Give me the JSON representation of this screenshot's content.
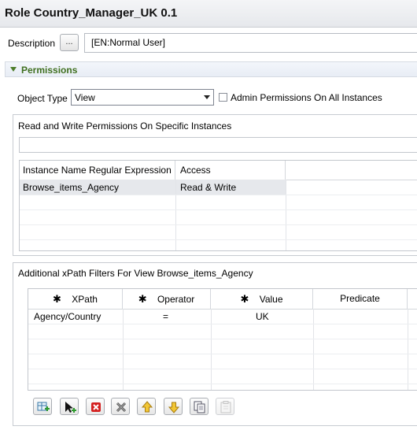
{
  "header": {
    "title": "Role Country_Manager_UK 0.1"
  },
  "description": {
    "label": "Description",
    "browse_label": "...",
    "value": "[EN:Normal User]"
  },
  "permissions": {
    "section_title": "Permissions",
    "object_type_label": "Object Type",
    "object_type_value": "View",
    "admin_checkbox_label": "Admin Permissions On All Instances",
    "admin_checked": false,
    "rw_group_title": "Read and Write Permissions On Specific Instances",
    "instance_filter_value": "",
    "instances_table": {
      "columns": [
        "Instance Name Regular Expression",
        "Access"
      ],
      "rows": [
        [
          "Browse_items_Agency",
          "Read & Write"
        ]
      ]
    },
    "xpath_group_title": "Additional xPath Filters For View Browse_items_Agency",
    "xpath_table": {
      "columns": [
        "XPath",
        "Operator",
        "Value",
        "Predicate"
      ],
      "rows": [
        [
          "Agency/Country",
          "=",
          "UK",
          ""
        ]
      ]
    }
  },
  "toolbar": {
    "buttons": [
      "add-row",
      "select-element",
      "delete",
      "delete-all",
      "move-up",
      "move-down",
      "copy",
      "paste"
    ],
    "disabled": [
      "paste"
    ]
  },
  "colors": {
    "section_text": "#3f6f1f",
    "delete_red": "#d42020",
    "arrow_yellow": "#f2c634"
  }
}
